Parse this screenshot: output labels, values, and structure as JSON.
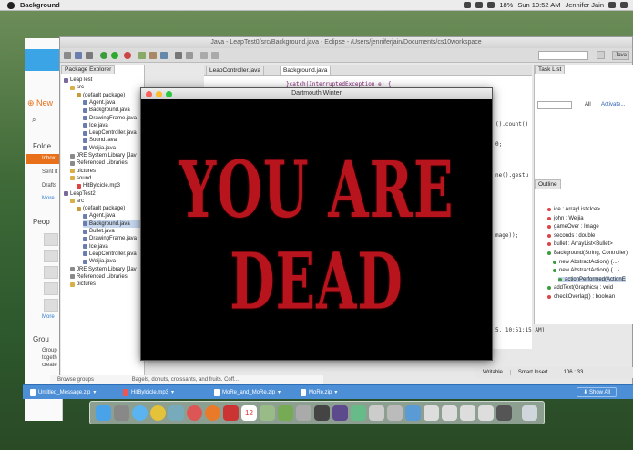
{
  "menubar": {
    "app_name": "Background",
    "battery": "18%",
    "clock": "Sun 10:52 AM",
    "user": "Jennifer Jain"
  },
  "mail": {
    "new_label": "New",
    "folders_label": "Folde",
    "items": [
      "Inbox",
      "Sent It",
      "Drafts",
      "More"
    ],
    "people_label": "Peop",
    "more_label": "More",
    "groups_label": "Grou",
    "groups_text": [
      "Group",
      "togeth",
      "create"
    ],
    "browse_groups": "Browse groups",
    "preview_text": "Bagels, donuts, croissants, and fruits. Coff..."
  },
  "eclipse": {
    "title": "Java - LeapTest0/src/Background.java - Eclipse - /Users/jenniferjain/Documents/cs10workspace",
    "quick_access_label": "Java",
    "package_explorer_tab": "Package Explorer",
    "tree": [
      {
        "label": "LeapTest",
        "depth": 0,
        "kind": "project"
      },
      {
        "label": "src",
        "depth": 1,
        "kind": "folder"
      },
      {
        "label": "(default package)",
        "depth": 2,
        "kind": "package"
      },
      {
        "label": "Agent.java",
        "depth": 3,
        "kind": "java"
      },
      {
        "label": "Background.java",
        "depth": 3,
        "kind": "java"
      },
      {
        "label": "DrawingFrame.java",
        "depth": 3,
        "kind": "java"
      },
      {
        "label": "Ice.java",
        "depth": 3,
        "kind": "java"
      },
      {
        "label": "LeapController.java",
        "depth": 3,
        "kind": "java"
      },
      {
        "label": "Sound.java",
        "depth": 3,
        "kind": "java"
      },
      {
        "label": "Weijia.java",
        "depth": 3,
        "kind": "java"
      },
      {
        "label": "JRE System Library [Jav",
        "depth": 1,
        "kind": "lib"
      },
      {
        "label": "Referenced Libraries",
        "depth": 1,
        "kind": "lib"
      },
      {
        "label": "pictures",
        "depth": 1,
        "kind": "folder"
      },
      {
        "label": "sound",
        "depth": 1,
        "kind": "folder"
      },
      {
        "label": "HitBylcicle.mp3",
        "depth": 2,
        "kind": "media"
      },
      {
        "label": "LeapTest2",
        "depth": 0,
        "kind": "project"
      },
      {
        "label": "src",
        "depth": 1,
        "kind": "folder"
      },
      {
        "label": "(default package)",
        "depth": 2,
        "kind": "package"
      },
      {
        "label": "Agent.java",
        "depth": 3,
        "kind": "java"
      },
      {
        "label": "Background.java",
        "depth": 3,
        "kind": "java"
      },
      {
        "label": "Bullet.java",
        "depth": 3,
        "kind": "java"
      },
      {
        "label": "DrawingFrame.java",
        "depth": 3,
        "kind": "java"
      },
      {
        "label": "Ice.java",
        "depth": 3,
        "kind": "java"
      },
      {
        "label": "LeapController.java",
        "depth": 3,
        "kind": "java"
      },
      {
        "label": "Weijia.java",
        "depth": 3,
        "kind": "java"
      },
      {
        "label": "JRE System Library [Jav",
        "depth": 1,
        "kind": "lib"
      },
      {
        "label": "Referenced Libraries",
        "depth": 1,
        "kind": "lib"
      },
      {
        "label": "pictures",
        "depth": 1,
        "kind": "folder"
      }
    ],
    "editor_tabs": [
      "LeapController.java",
      "Background.java"
    ],
    "code": [
      "}catch(InterruptedException e) {",
      "().count()",
      "0;",
      "ne().gestu",
      "mage));",
      "5, 10:51:15 AM)"
    ],
    "task_list_tab": "Task List",
    "task_filters": [
      "All",
      "Activate..."
    ],
    "outline_tab": "Outline",
    "outline_items": [
      "ice : ArrayList<Ice>",
      "john : Weijia",
      "gameOver : Image",
      "seconds : double",
      "bullet : ArrayList<Bullet>",
      "Background(String, Controller)",
      "new AbstractAction() {...}",
      "new AbstractAction() {...}",
      "actionPerformed(ActionE",
      "addText(Graphics) : void",
      "checkOverlap() : boolean"
    ],
    "status": [
      "Writable",
      "Smart Insert",
      "106 : 33"
    ]
  },
  "game": {
    "title": "Dartmouth Winter",
    "message": "YOU ARE DEAD"
  },
  "downloads": {
    "items": [
      "Untitled_Message.zip",
      "HitBylcicle.mp3",
      "MoRe_and_MoRe.zip",
      "MoRe.zip"
    ],
    "show_all": "Show All"
  },
  "dock": {
    "calendar_day": "12"
  },
  "colors": {
    "dead_red": "#b8141e",
    "downloads_blue": "#4d8fd6",
    "mail_accent": "#3aa4e6"
  }
}
